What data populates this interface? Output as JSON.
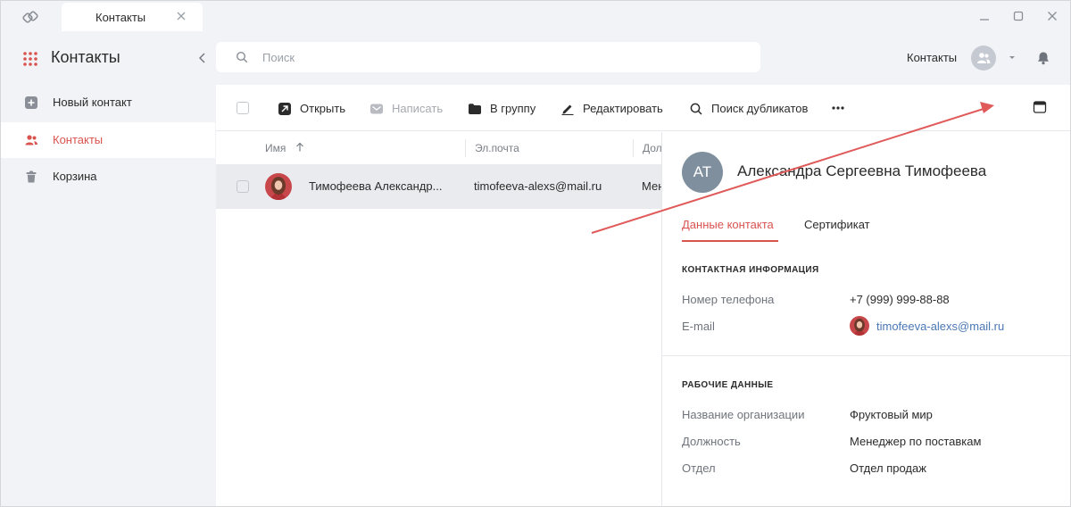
{
  "titlebar": {
    "tab_label": "Контакты",
    "icons": {
      "logo": "app-logo-icon",
      "close": "close-icon",
      "minimize": "minimize-icon",
      "maximize": "maximize-icon",
      "window_close": "window-close-icon"
    }
  },
  "sidebar": {
    "title": "Контакты",
    "items": [
      {
        "label": "Новый контакт",
        "icon": "plus-square-icon",
        "active": false
      },
      {
        "label": "Контакты",
        "icon": "users-icon",
        "active": true
      },
      {
        "label": "Корзина",
        "icon": "trash-icon",
        "active": false
      }
    ]
  },
  "header": {
    "search_placeholder": "Поиск",
    "context_label": "Контакты"
  },
  "toolbar": {
    "open": "Открыть",
    "write": "Написать",
    "to_group": "В группу",
    "edit": "Редактировать",
    "find_duplicates": "Поиск дубликатов",
    "more": "•••"
  },
  "list": {
    "columns": [
      "Имя",
      "Эл.почта",
      "Дол"
    ],
    "rows": [
      {
        "name": "Тимофеева Александр...",
        "email": "timofeeva-alexs@mail.ru",
        "position": "Мен"
      }
    ]
  },
  "detail": {
    "initials": "АТ",
    "full_name": "Александра Сергеевна Тимофеева",
    "tabs": [
      "Данные контакта",
      "Сертификат"
    ],
    "contact_section": "КОНТАКТНАЯ ИНФОРМАЦИЯ",
    "phone_label": "Номер телефона",
    "phone_value": "+7 (999) 999-88-88",
    "email_label": "E-mail",
    "email_value": "timofeeva-alexs@mail.ru",
    "work_section": "РАБОЧИЕ ДАННЫЕ",
    "org_label": "Название организации",
    "org_value": "Фруктовый мир",
    "position_label": "Должность",
    "position_value": "Менеджер по поставкам",
    "dept_label": "Отдел",
    "dept_value": "Отдел продаж"
  },
  "colors": {
    "accent": "#d9534f",
    "link": "#4a78b5",
    "annotation_arrow": "#e05a5a",
    "avatar_bg": "#7f8f9d"
  }
}
